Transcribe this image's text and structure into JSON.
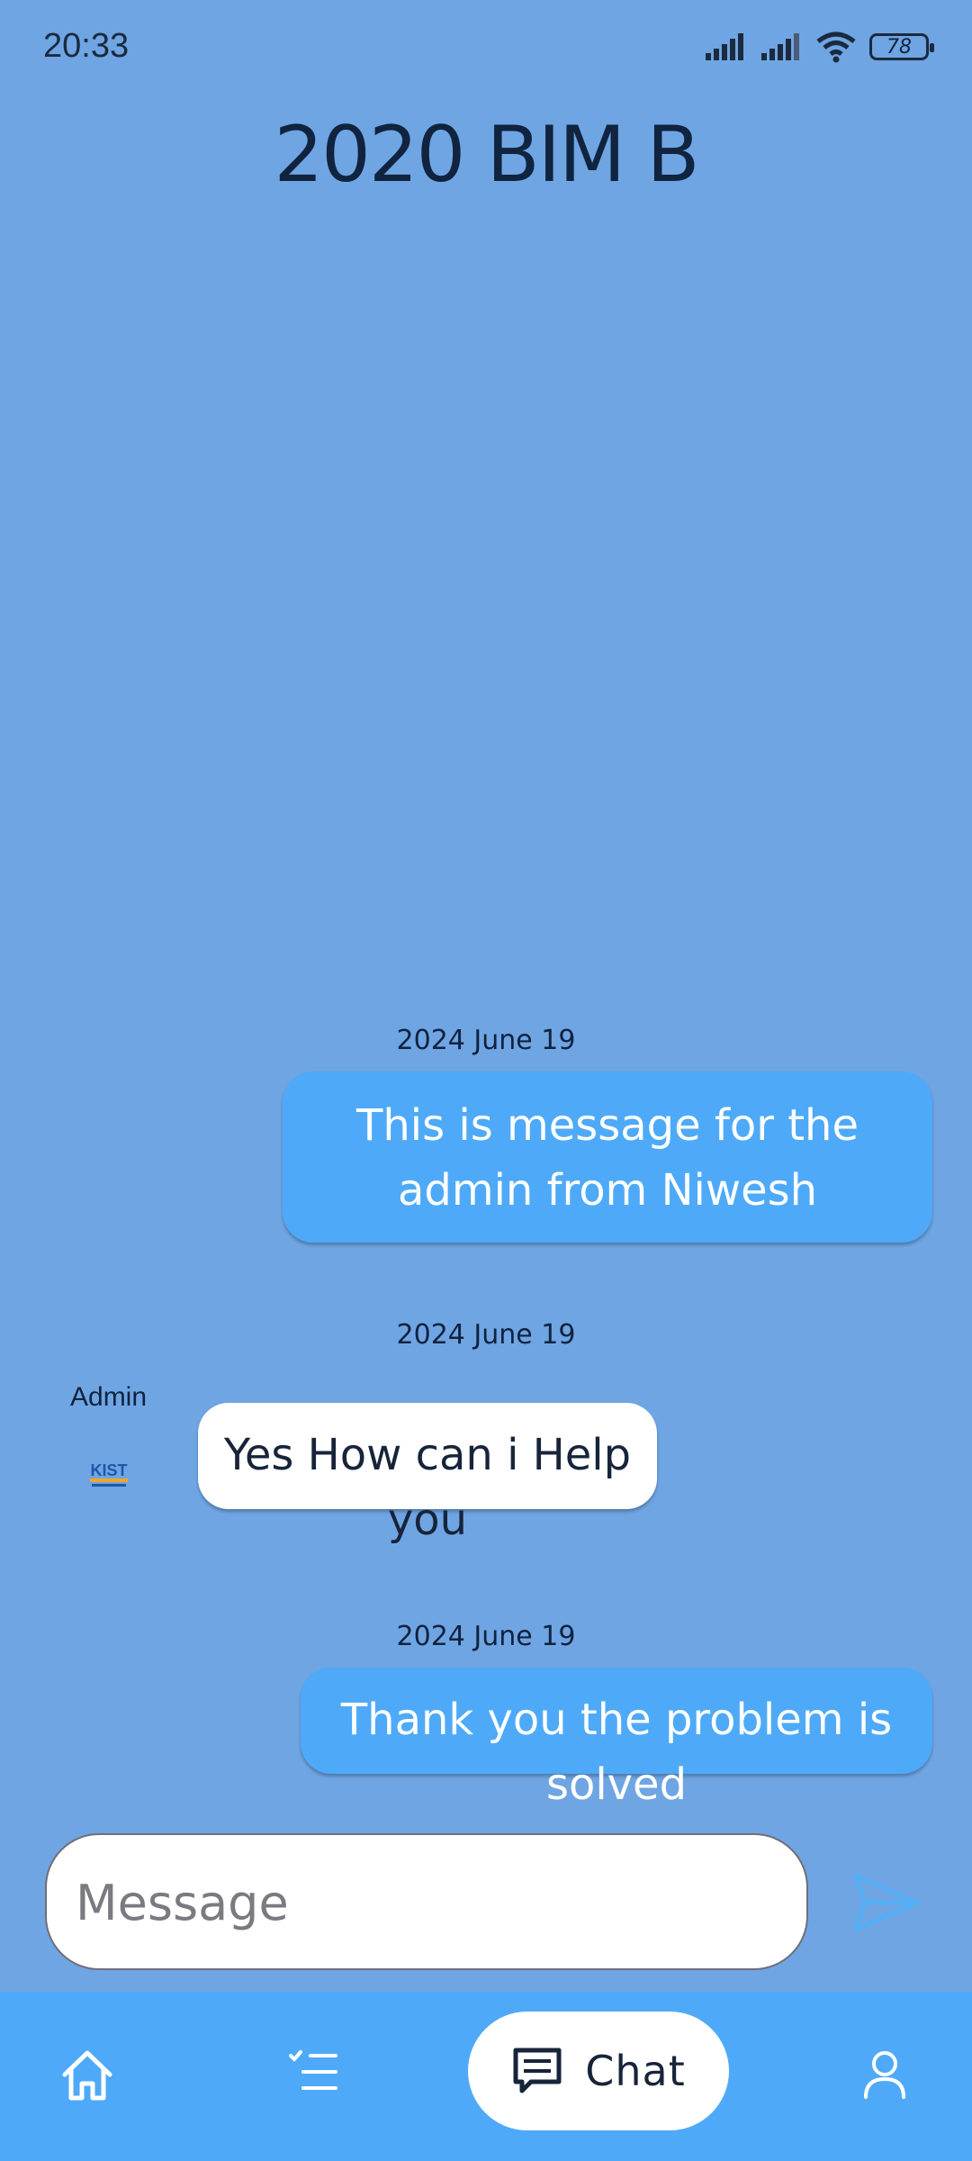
{
  "status_bar": {
    "time": "20:33",
    "battery": "78",
    "icons": [
      "signal-icon",
      "signal-icon",
      "wifi-icon",
      "battery-icon"
    ]
  },
  "header": {
    "title": "2020 BIM B"
  },
  "messages": [
    {
      "date": "2024 June 19",
      "direction": "sent",
      "text": "This is message for the admin from Niwesh"
    },
    {
      "date": "2024 June 19",
      "direction": "received",
      "sender": "Admin",
      "avatar_text": "KIST",
      "text": "Yes How can i Help you"
    },
    {
      "date": "2024 June 19",
      "direction": "sent",
      "text": "Thank you the problem is solved"
    }
  ],
  "composer": {
    "placeholder": "Message",
    "value": "",
    "send_icon": "send-icon"
  },
  "bottom_nav": {
    "items": [
      {
        "icon": "home-icon"
      },
      {
        "icon": "task-list-icon"
      },
      {
        "icon": "chat-icon",
        "label": "Chat",
        "active": true
      },
      {
        "icon": "profile-icon"
      }
    ]
  },
  "colors": {
    "background": "#6fa5e3",
    "sent_bubble": "#4eaaf8",
    "received_bubble": "#ffffff",
    "nav_bar": "#4eaaf8"
  }
}
